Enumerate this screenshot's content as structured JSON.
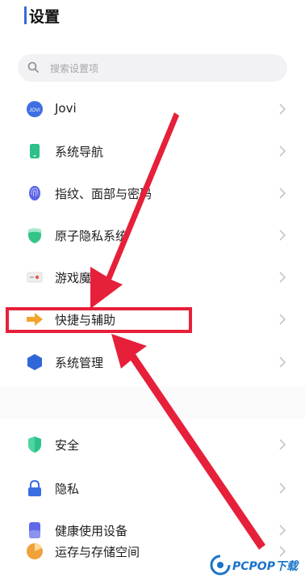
{
  "header": {
    "title": "设置"
  },
  "search": {
    "placeholder": "搜索设置项",
    "icon": "search-icon"
  },
  "items": [
    {
      "label": "Jovi",
      "icon": "jovi-icon",
      "color": "#3d6fe0"
    },
    {
      "label": "系统导航",
      "icon": "phone-icon",
      "color": "#2fbf8a"
    },
    {
      "label": "指纹、面部与密码",
      "icon": "fingerprint-icon",
      "color": "#5b63e6"
    },
    {
      "label": "原子隐私系统",
      "icon": "shield-icon",
      "color": "#34c489"
    },
    {
      "label": "游戏魔盒",
      "icon": "gamebox-icon",
      "color": "#e35a5a"
    },
    {
      "label": "快捷与辅助",
      "icon": "arrow-right-icon",
      "color": "#f3a42c"
    },
    {
      "label": "系统管理",
      "icon": "hexagon-icon",
      "color": "#2f67d8"
    },
    {
      "label": "安全",
      "icon": "security-shield-icon",
      "color": "#2ec18a"
    },
    {
      "label": "隐私",
      "icon": "lock-icon",
      "color": "#3b6ee2"
    },
    {
      "label": "健康使用设备",
      "icon": "hourglass-icon",
      "color": "#5f68e6"
    },
    {
      "label": "运存与存储空间",
      "icon": "storage-icon",
      "color": "#f0a13a"
    }
  ],
  "annotation": {
    "highlight_color": "#e6203a",
    "highlighted_item": "快捷与辅助"
  },
  "watermark": {
    "text": "PCPOP下载",
    "color": "#1a73c9"
  }
}
